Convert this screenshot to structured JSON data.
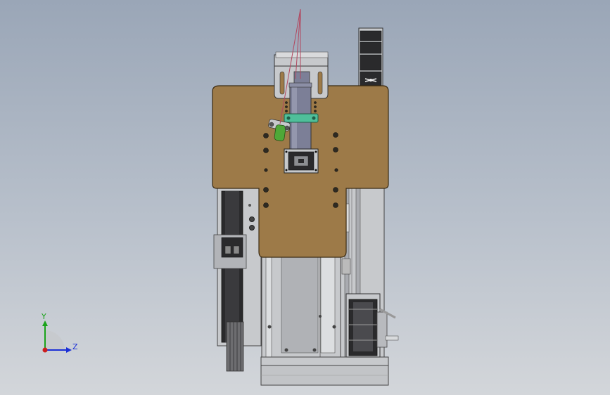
{
  "viewport": {
    "background_top": "#9aa6b7",
    "background_bottom": "#d3d6da"
  },
  "triad": {
    "y_label": "Y",
    "z_label": "Z",
    "y_color": "#1aa31a",
    "z_color": "#1b2fd6",
    "x_color": "#cc1e1e"
  },
  "colors": {
    "plate": "#9d7a48",
    "metal_light": "#c7c9cc",
    "metal_mid": "#9a9ca1",
    "tube": "#7c7f97",
    "clamp": "#4fbf9a",
    "dark": "#2a2a2c",
    "laser_line": "#b2475f",
    "green_part": "#4fa838"
  }
}
